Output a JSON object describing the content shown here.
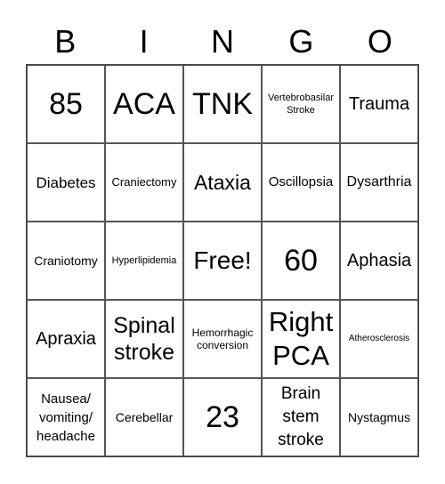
{
  "header": [
    "B",
    "I",
    "N",
    "G",
    "O"
  ],
  "cells": [
    "85",
    "ACA",
    "TNK",
    "Vertebrobasilar Stroke",
    "Trauma",
    "Diabetes",
    "Craniectomy",
    "Ataxia",
    "Oscillopsia",
    "Dysarthria",
    "Craniotomy",
    "Hyperlipidemia",
    "Free!",
    "60",
    "Aphasia",
    "Apraxia",
    "Spinal stroke",
    "Hemorrhagic conversion",
    "Right PCA",
    "Atherosclerosis",
    "Nausea/ vomiting/ headache",
    "Cerebellar",
    "23",
    "Brain stem stroke",
    "Nystagmus"
  ]
}
